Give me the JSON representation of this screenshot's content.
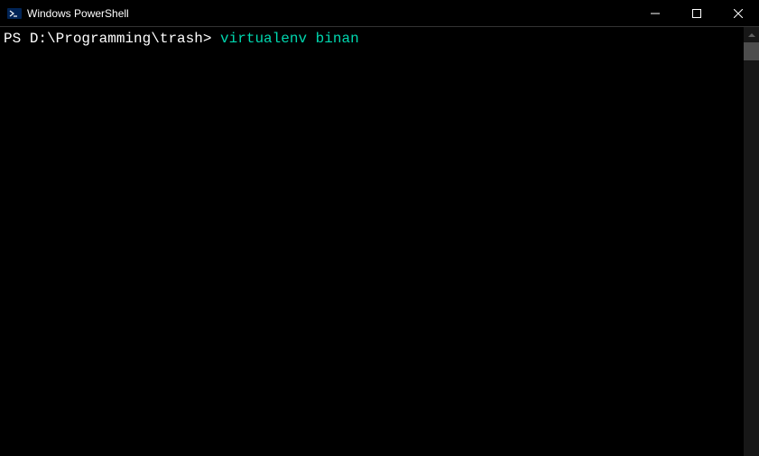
{
  "window": {
    "title": "Windows PowerShell"
  },
  "terminal": {
    "prompt_prefix": "PS ",
    "path": "D:\\Programming\\trash",
    "caret": "> ",
    "command": "virtualenv",
    "argument": " binan"
  }
}
